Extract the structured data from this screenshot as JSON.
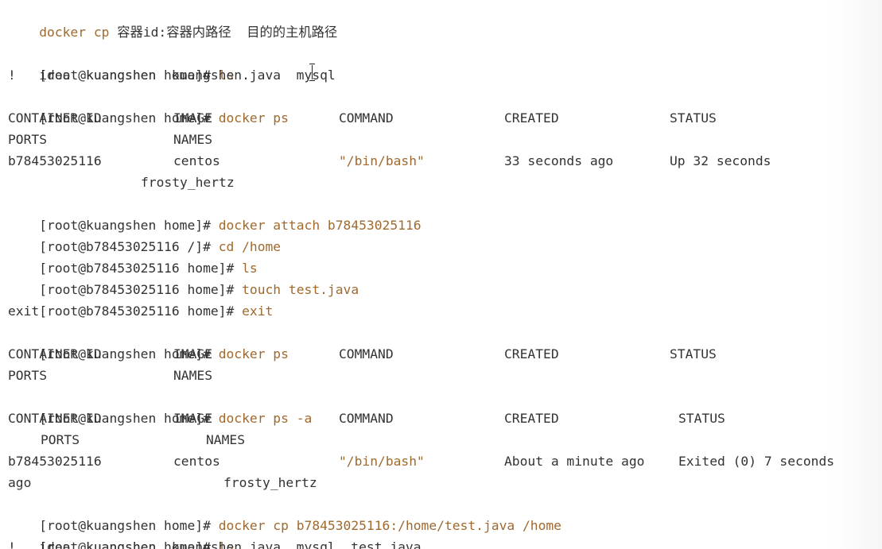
{
  "terminal": {
    "header": {
      "cmd": "docker cp",
      "rest": " 容器id:容器内路径  目的的主机路径"
    },
    "prompt_host_home": "[root@kuangshen home]#",
    "prompt_container_root": "[root@b78453025116 /]#",
    "prompt_container_home": "[root@b78453025116 home]#",
    "cmd_ls": "ls",
    "ls_output_1": "!   idea  kuangshen  kuangshen.java  mysql",
    "cmd_docker_ps": "docker ps",
    "ps_header": {
      "container_id": "CONTAINER ID",
      "image": "IMAGE",
      "command": "COMMAND",
      "created": "CREATED",
      "status": "STATUS",
      "ports": "PORTS",
      "names": "NAMES"
    },
    "ps_row": {
      "container_id": "b78453025116",
      "image": "centos",
      "command": "\"/bin/bash\"",
      "created": "33 seconds ago",
      "status": "Up 32 seconds",
      "names": "frosty_hertz"
    },
    "cmd_attach": "docker attach b78453025116",
    "cmd_cd_home": "cd /home",
    "cmd_touch": "touch test.java",
    "cmd_exit": "exit",
    "exit_output": "exit",
    "cmd_docker_ps_a": "docker ps -a",
    "psa_row": {
      "container_id": "b78453025116",
      "image": "centos",
      "command": "\"/bin/bash\"",
      "created": "About a minute ago",
      "status": "Exited (0) 7 seconds",
      "status_cont": "ago",
      "names": "frosty_hertz"
    },
    "cmd_cp": "docker cp b78453025116:/home/test.java /home",
    "ls_output_2": "!   idea  kuangshen  kuangshen.java  mysql  test.java"
  }
}
